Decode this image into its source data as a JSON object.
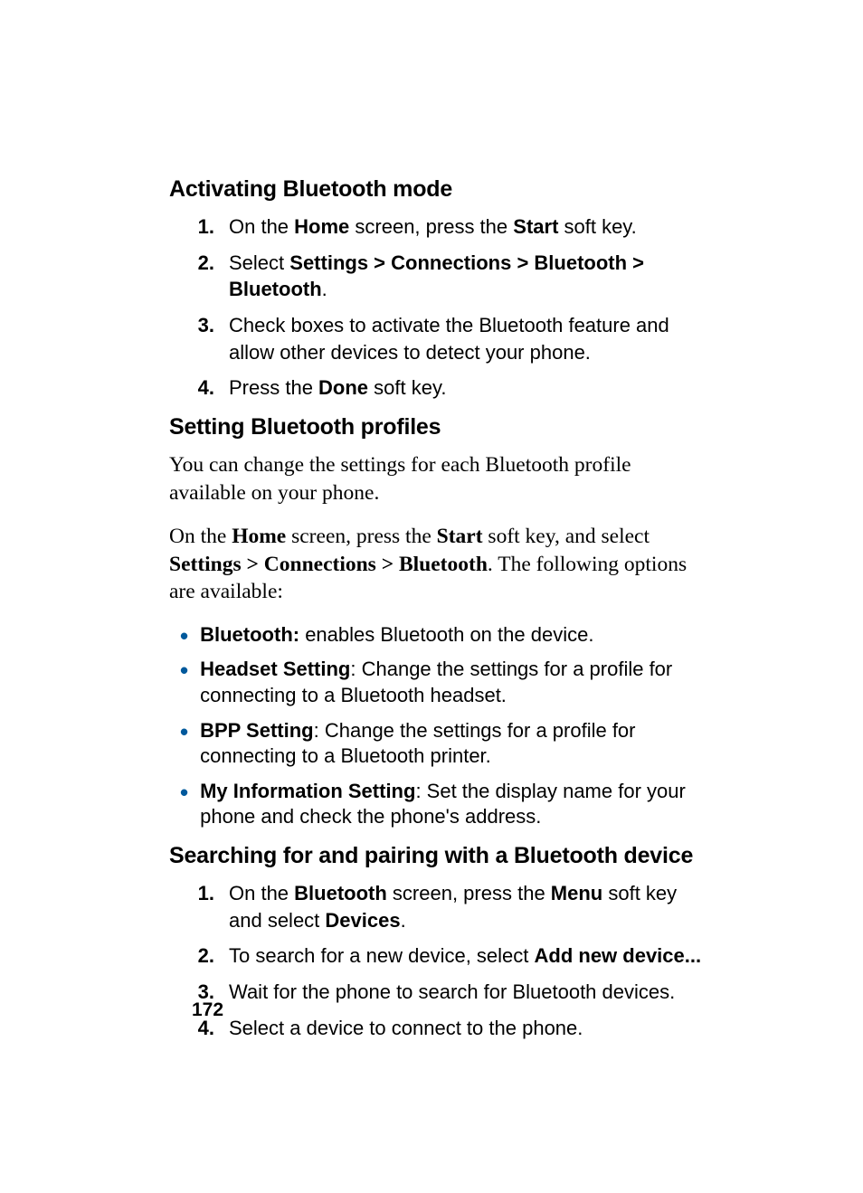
{
  "section1": {
    "heading": "Activating Bluetooth mode",
    "steps": [
      {
        "num": "1.",
        "pre": "On the ",
        "b1": "Home",
        "mid": " screen, press the ",
        "b2": "Start",
        "post": " soft key."
      },
      {
        "num": "2.",
        "pre": "Select ",
        "b1": "Settings > Connections > Bluetooth > Bluetooth",
        "mid": "",
        "b2": "",
        "post": "."
      },
      {
        "num": "3.",
        "pre": "Check boxes to activate the Bluetooth feature and allow other devices to detect your phone.",
        "b1": "",
        "mid": "",
        "b2": "",
        "post": ""
      },
      {
        "num": "4.",
        "pre": "Press the ",
        "b1": "Done",
        "mid": " soft key.",
        "b2": "",
        "post": ""
      }
    ]
  },
  "section2": {
    "heading": "Setting Bluetooth profiles",
    "p1": "You can change the settings for each Bluetooth profile available on your phone.",
    "p2": {
      "t1": "On the ",
      "b1": "Home",
      "t2": " screen, press the ",
      "b2": "Start",
      "t3": " soft key, and select ",
      "b3": "Settings > Connections > Bluetooth",
      "t4": ". The following options are available:"
    },
    "bullets": [
      {
        "bold": "Bluetooth:",
        "rest": " enables Bluetooth on the device."
      },
      {
        "bold": "Headset Setting",
        "rest": ": Change the settings for a profile for connecting to a Bluetooth headset."
      },
      {
        "bold": "BPP Setting",
        "rest": ": Change the settings for a profile for connecting to a Bluetooth printer."
      },
      {
        "bold": "My Information Setting",
        "rest": ": Set the display name for your phone and check the phone's address."
      }
    ]
  },
  "section3": {
    "heading": "Searching for and pairing with a Bluetooth device",
    "steps": [
      {
        "num": "1.",
        "pre": "On the ",
        "b1": "Bluetooth",
        "mid": " screen, press the ",
        "b2": "Menu",
        "post": " soft key and select ",
        "b3": "Devices",
        "tail": "."
      },
      {
        "num": "2.",
        "pre": "To search for a new device, select ",
        "b1": "Add new device...",
        "mid": "",
        "b2": "",
        "post": "",
        "b3": "",
        "tail": ""
      },
      {
        "num": "3.",
        "pre": "Wait for the phone to search for Bluetooth devices.",
        "b1": "",
        "mid": "",
        "b2": "",
        "post": "",
        "b3": "",
        "tail": ""
      },
      {
        "num": "4.",
        "pre": "Select a device to connect to the phone.",
        "b1": "",
        "mid": "",
        "b2": "",
        "post": "",
        "b3": "",
        "tail": ""
      }
    ]
  },
  "pageNumber": "172"
}
